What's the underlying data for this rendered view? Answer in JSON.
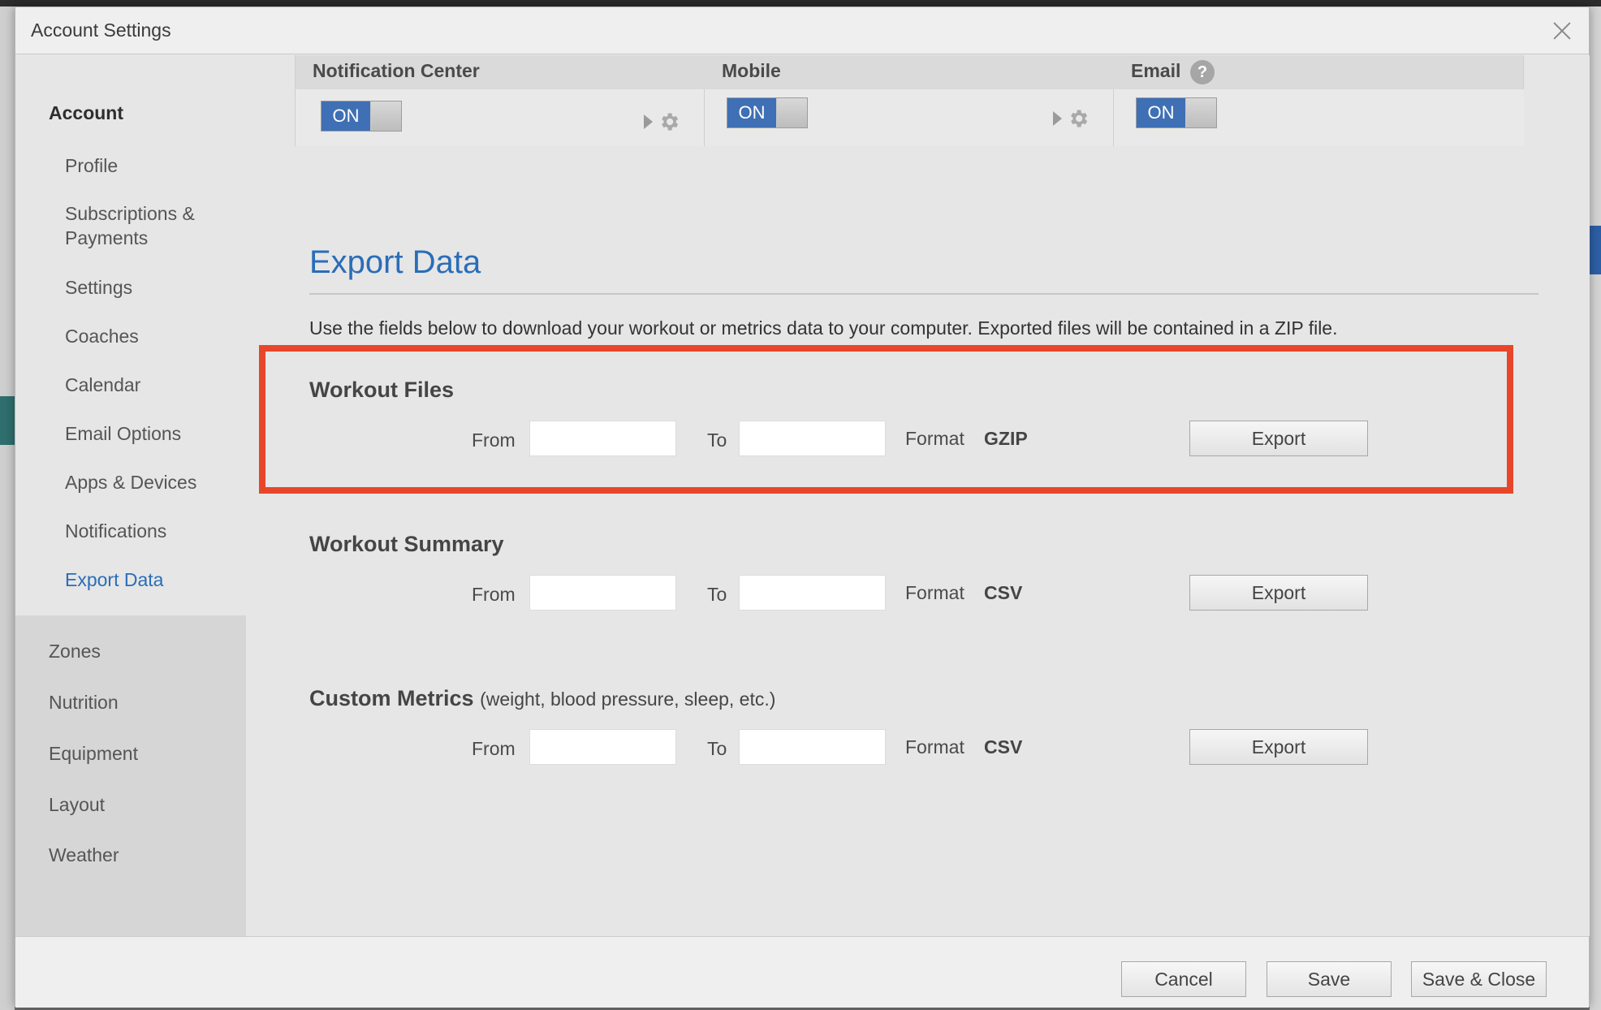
{
  "modal": {
    "title": "Account Settings"
  },
  "sidebar": {
    "header": "Account",
    "items": [
      {
        "label": "Profile"
      },
      {
        "label": "Subscriptions &"
      },
      {
        "label": "Payments"
      },
      {
        "label": "Settings"
      },
      {
        "label": "Coaches"
      },
      {
        "label": "Calendar"
      },
      {
        "label": "Email Options"
      },
      {
        "label": "Apps & Devices"
      },
      {
        "label": "Notifications"
      },
      {
        "label": "Export Data"
      }
    ],
    "sections": [
      {
        "label": "Zones"
      },
      {
        "label": "Nutrition"
      },
      {
        "label": "Equipment"
      },
      {
        "label": "Layout"
      },
      {
        "label": "Weather"
      }
    ]
  },
  "notifications": {
    "columns": [
      {
        "title": "Notification Center",
        "toggle": "ON"
      },
      {
        "title": "Mobile",
        "toggle": "ON"
      },
      {
        "title": "Email",
        "toggle": "ON",
        "help": "?"
      }
    ]
  },
  "export": {
    "title": "Export Data",
    "description": "Use the fields below to download your workout or metrics data to your computer. Exported files will be contained in a ZIP file.",
    "from_label": "From",
    "to_label": "To",
    "format_label": "Format",
    "export_label": "Export",
    "groups": [
      {
        "title": "Workout Files",
        "subtitle": "",
        "format": "GZIP",
        "from": "",
        "to": ""
      },
      {
        "title": "Workout Summary",
        "subtitle": "",
        "format": "CSV",
        "from": "",
        "to": ""
      },
      {
        "title": "Custom Metrics",
        "subtitle": "(weight, blood pressure, sleep, etc.)",
        "format": "CSV",
        "from": "",
        "to": ""
      }
    ]
  },
  "footer": {
    "cancel": "Cancel",
    "save": "Save",
    "save_close": "Save & Close"
  },
  "colors": {
    "accent": "#2a6db8",
    "toggle_on": "#3f6fb5",
    "highlight": "#e8462a"
  }
}
